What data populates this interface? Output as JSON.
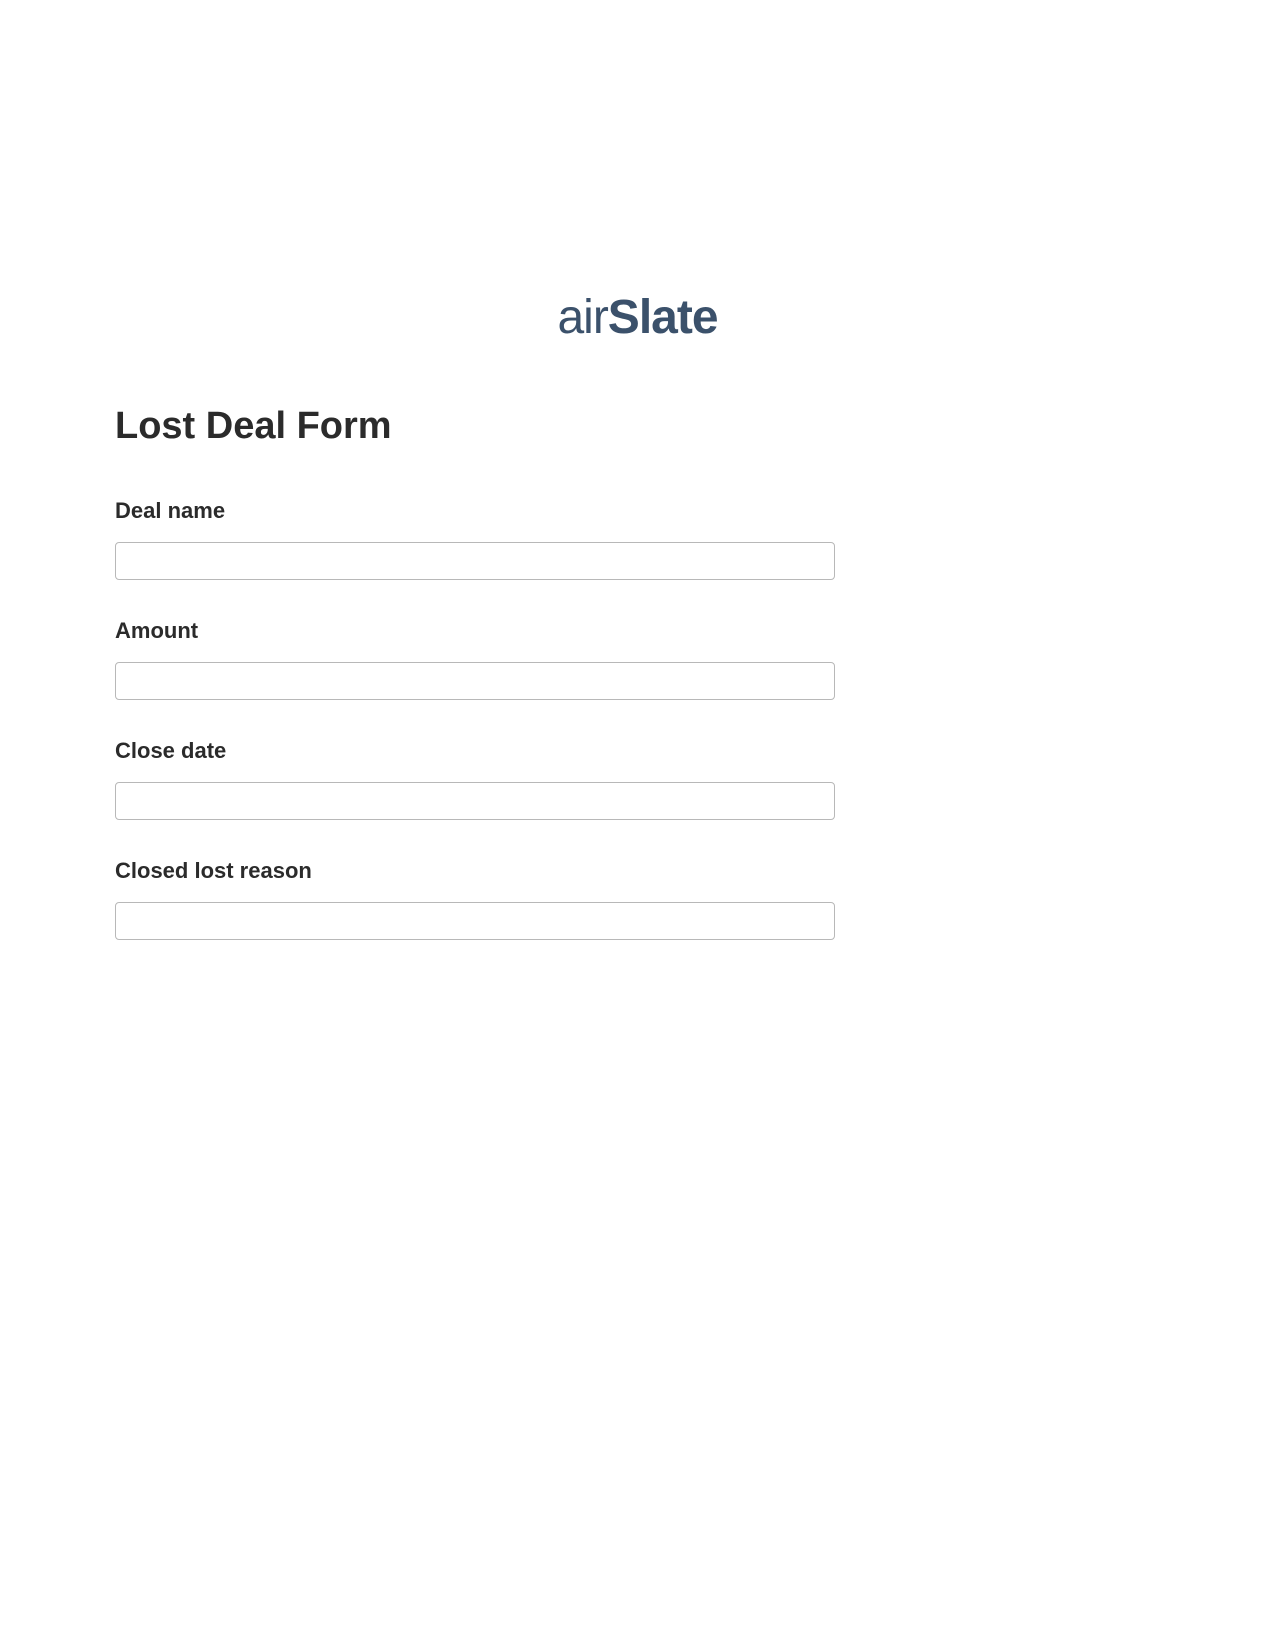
{
  "logo": {
    "part1": "air",
    "part2": "Slate"
  },
  "form": {
    "title": "Lost Deal Form",
    "fields": [
      {
        "label": "Deal name",
        "value": ""
      },
      {
        "label": "Amount",
        "value": ""
      },
      {
        "label": "Close date",
        "value": ""
      },
      {
        "label": "Closed lost reason",
        "value": ""
      }
    ]
  }
}
